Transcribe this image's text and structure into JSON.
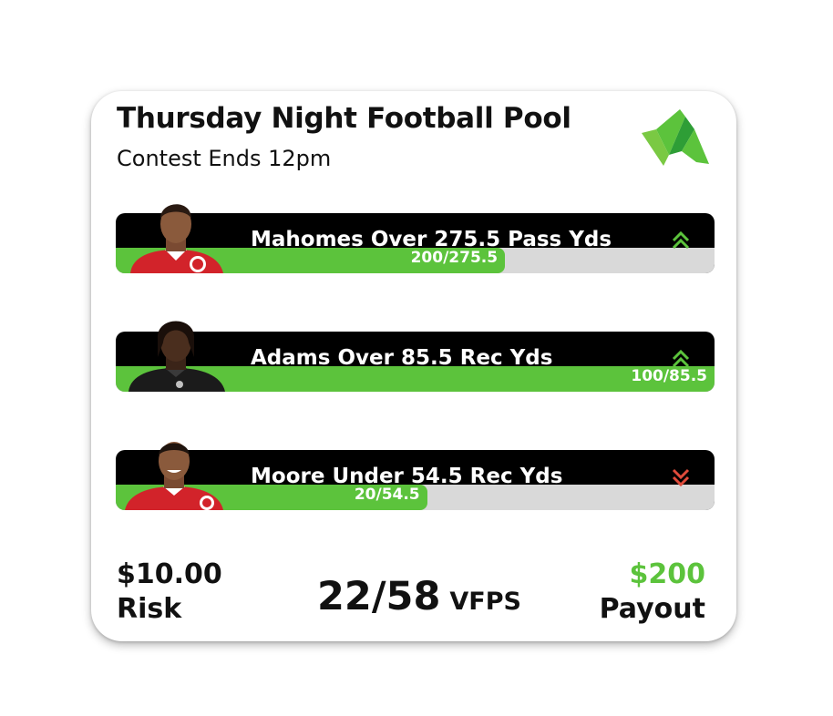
{
  "contest": {
    "title": "Thursday Night Football Pool",
    "subtitle": "Contest Ends 12pm",
    "logo": "brand-logo"
  },
  "props": [
    {
      "label": "Mahomes Over 275.5 Pass Yds",
      "value_text": "200/275.5",
      "progress": 0.65,
      "trend": "up",
      "trend_color": "#5cc33c",
      "avatar_color": "#d2232a",
      "avatar_icon": "player-photo"
    },
    {
      "label": "Adams Over 85.5 Rec Yds",
      "value_text": "100/85.5",
      "progress": 1.0,
      "trend": "up",
      "trend_color": "#5cc33c",
      "avatar_color": "#1b1b1b",
      "avatar_icon": "player-photo"
    },
    {
      "label": "Moore Under 54.5 Rec Yds",
      "value_text": "20/54.5",
      "progress": 0.52,
      "trend": "down",
      "trend_color": "#e04b3b",
      "avatar_color": "#d2232a",
      "avatar_icon": "player-photo"
    }
  ],
  "footer": {
    "risk_amount": "$10.00",
    "risk_label": "Risk",
    "score": "22/58",
    "score_unit": "VFPS",
    "payout_amount": "$200",
    "payout_label": "Payout"
  },
  "colors": {
    "accent": "#5cc33c",
    "track": "#d9d9d9",
    "down": "#e04b3b"
  }
}
